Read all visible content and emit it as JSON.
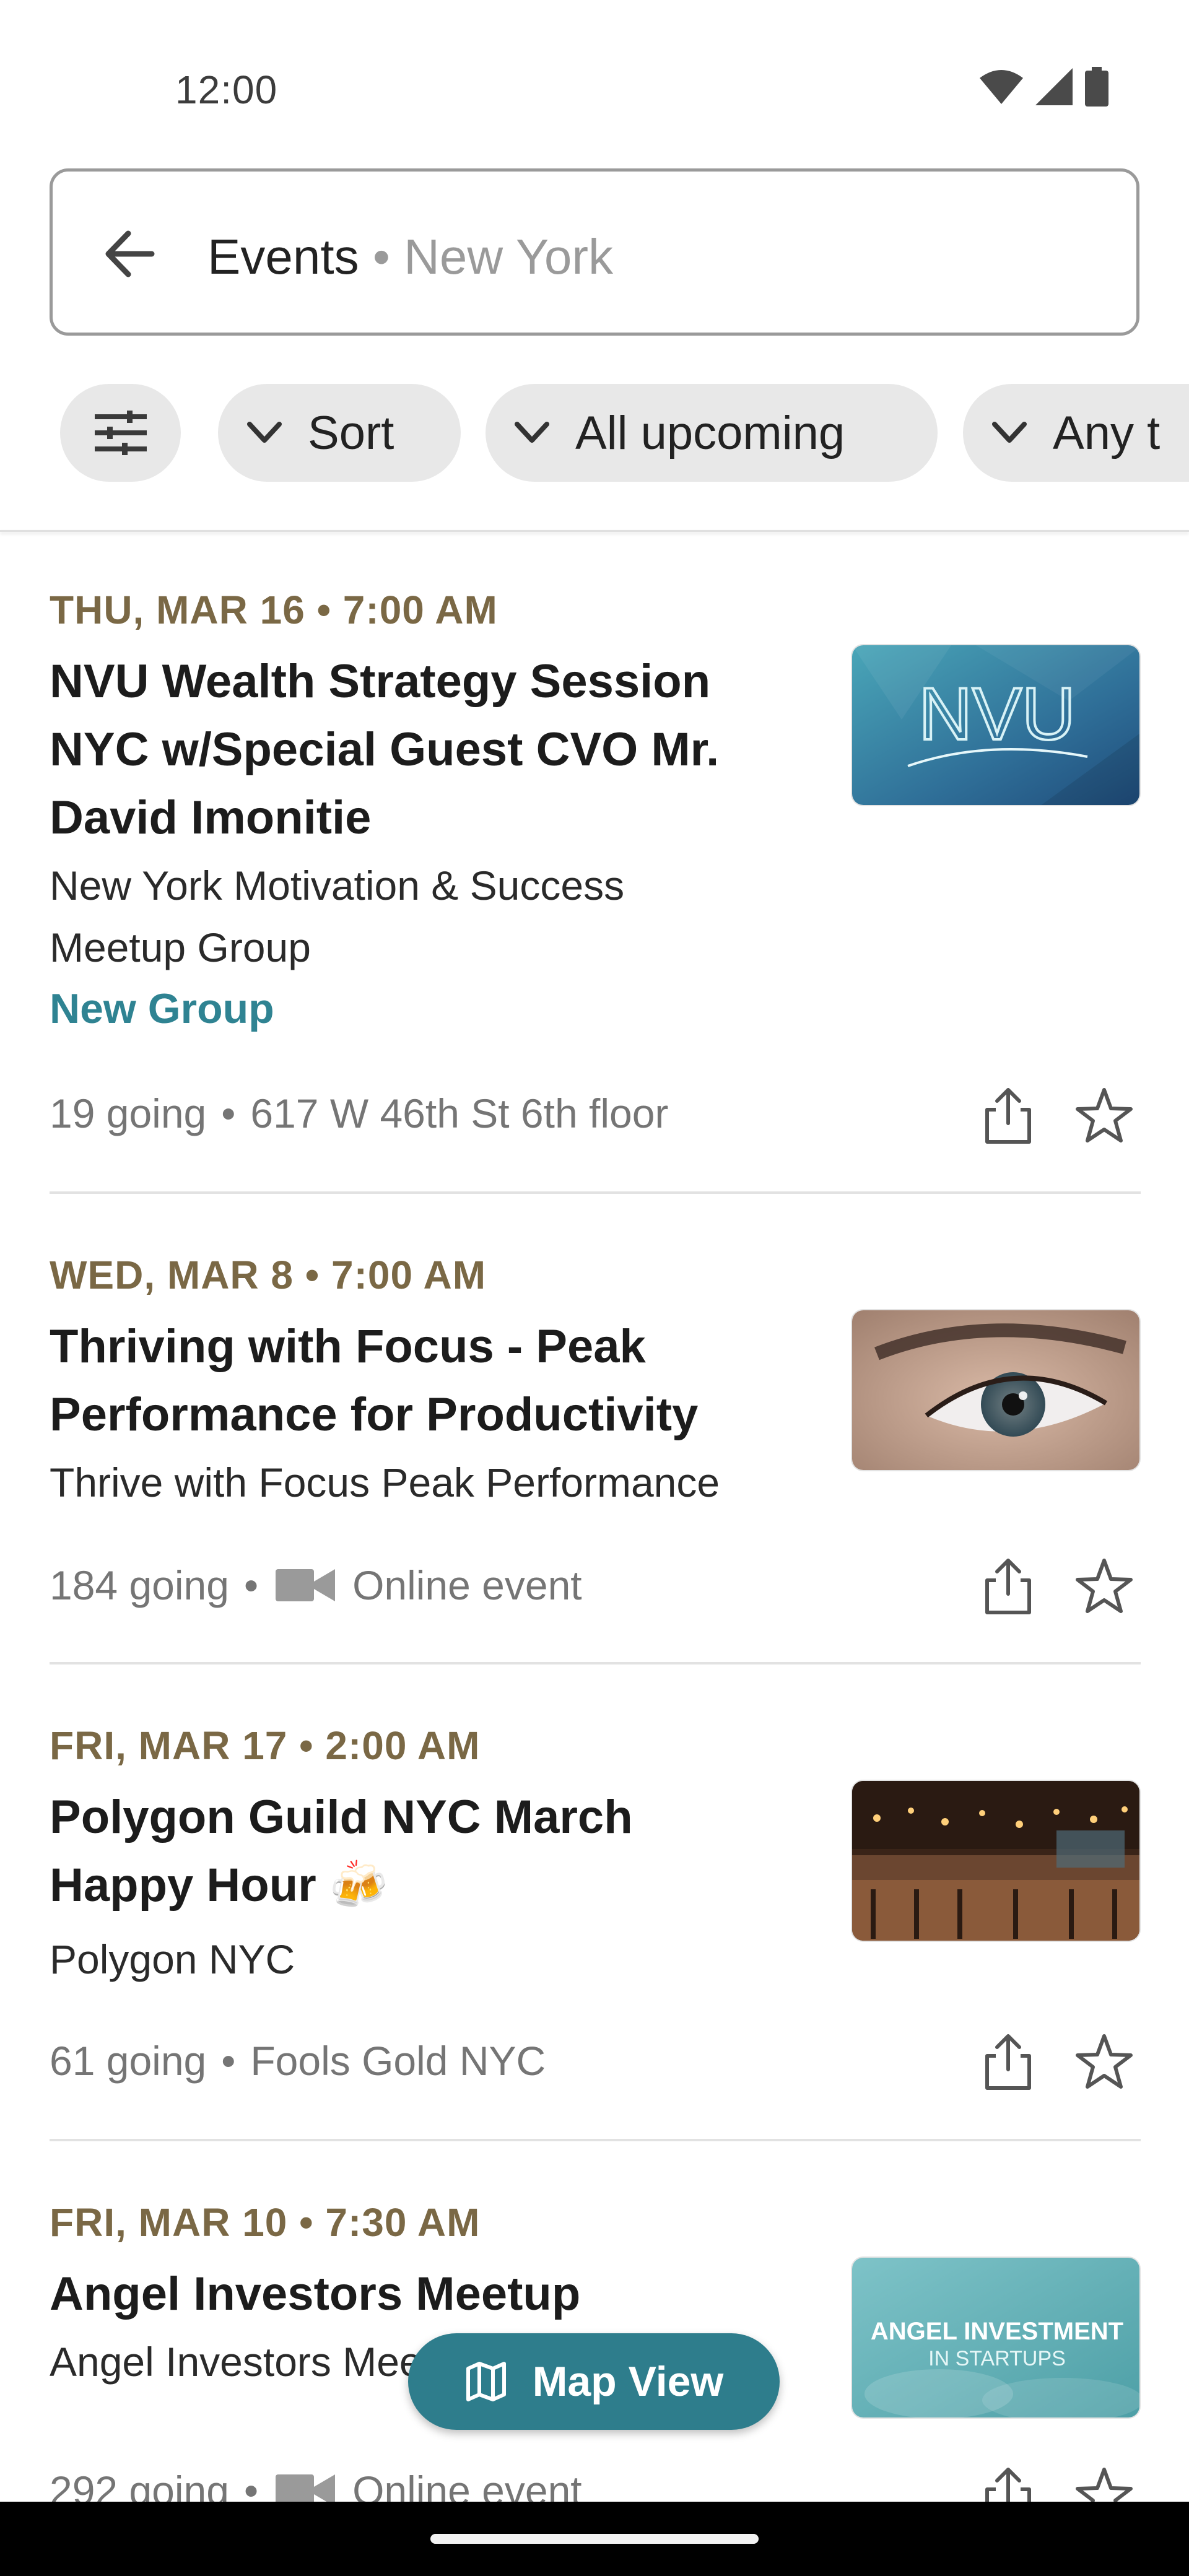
{
  "status_bar": {
    "time": "12:00"
  },
  "search": {
    "query": "Events",
    "separator": "•",
    "location": "New York"
  },
  "filters": {
    "chips": [
      {
        "label": "Sort"
      },
      {
        "label": "All upcoming"
      },
      {
        "label": "Any t"
      }
    ]
  },
  "events": [
    {
      "date": "THU, MAR 16 • 7:00 AM",
      "title": "NVU Wealth Strategy Session NYC w/Special Guest CVO Mr. David Imonitie",
      "group": "New York Motivation & Success Meetup Group",
      "tag": "New Group",
      "going": "19 going",
      "meta_sep": "•",
      "location": "617 W 46th St 6th floor",
      "thumbnail_text": "NVU"
    },
    {
      "date": "WED, MAR 8 • 7:00 AM",
      "title": "Thriving with Focus - Peak Performance for Productivity",
      "group": "Thrive with Focus Peak Performance",
      "going": "184 going",
      "meta_sep": "•",
      "location": "Online event"
    },
    {
      "date": "FRI, MAR 17 • 2:00 AM",
      "title": "Polygon Guild NYC March Happy Hour 🍻",
      "group": "Polygon NYC",
      "going": "61 going",
      "meta_sep": "•",
      "location": "Fools Gold NYC"
    },
    {
      "date": "FRI, MAR 10 • 7:30 AM",
      "title": "Angel Investors Meetup",
      "group": "Angel Investors Meetup",
      "going": "292 going",
      "meta_sep": "•",
      "location": "Online event",
      "thumbnail_text_1": "ANGEL INVESTMENT",
      "thumbnail_text_2": "IN STARTUPS"
    }
  ],
  "map_button": {
    "label": "Map View"
  },
  "colors": {
    "accent": "#2e7d8c",
    "date": "#7a6845",
    "tag": "#2f8392"
  }
}
